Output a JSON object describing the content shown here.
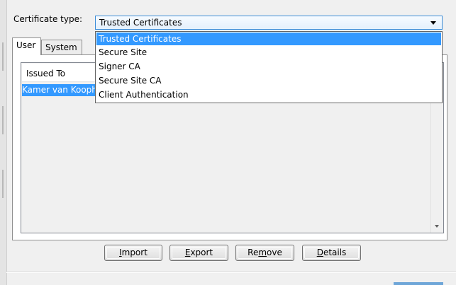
{
  "certificate_type": {
    "label": "Certificate type:",
    "selected_value": "Trusted Certificates",
    "options": [
      "Trusted Certificates",
      "Secure Site",
      "Signer CA",
      "Secure Site CA",
      "Client Authentication"
    ]
  },
  "tabs": [
    {
      "label": "User"
    },
    {
      "label": "System"
    }
  ],
  "list": {
    "columns": [
      "Issued To"
    ],
    "rows": [
      {
        "issued_to": "Kamer van Koophandel"
      }
    ]
  },
  "buttons": {
    "import": {
      "pre": "",
      "key": "I",
      "post": "mport"
    },
    "export": {
      "pre": "",
      "key": "E",
      "post": "xport"
    },
    "remove": {
      "pre": "Re",
      "key": "m",
      "post": "ove"
    },
    "details": {
      "pre": "",
      "key": "D",
      "post": "etails"
    }
  },
  "colors": {
    "selection": "#3399ff",
    "combo_border": "#3a8cd8",
    "background": "#f0f0f0"
  },
  "icons": {
    "combo_arrow": "chevron-down-icon",
    "scroll_down": "scroll-down-arrow-icon"
  }
}
